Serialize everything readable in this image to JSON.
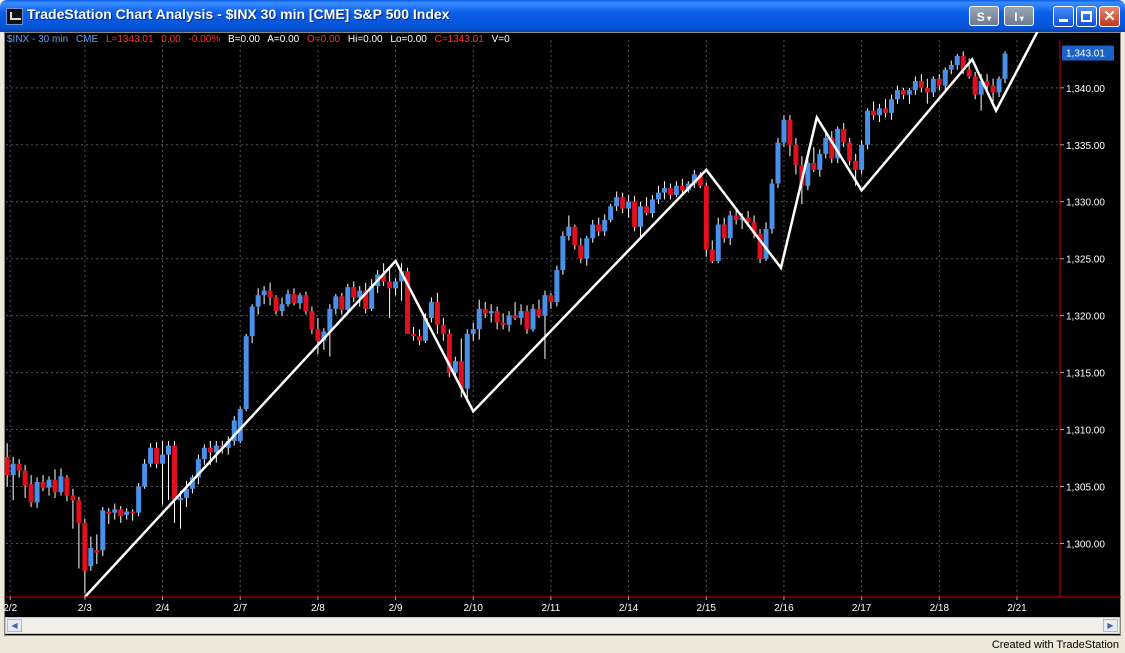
{
  "window": {
    "title": "TradeStation Chart Analysis - $INX 30 min [CME] S&P 500 Index",
    "menu_buttons": [
      "S",
      "I"
    ]
  },
  "status_bar": [
    {
      "text": "$INX - 30 min",
      "color": "#5aa0ff"
    },
    {
      "text": "CME",
      "color": "#5aa0ff"
    },
    {
      "text": "L=1343.01",
      "color": "#ff3030"
    },
    {
      "text": "0.00",
      "color": "#ff3030"
    },
    {
      "text": "-0.00%",
      "color": "#ff3030"
    },
    {
      "text": "B=0.00",
      "color": "#ffffff"
    },
    {
      "text": "A=0.00",
      "color": "#ffffff"
    },
    {
      "text": "O=0.00",
      "color": "#ff3030"
    },
    {
      "text": "Hi=0.00",
      "color": "#ffffff"
    },
    {
      "text": "Lo=0.00",
      "color": "#ffffff"
    },
    {
      "text": "C=1343.01",
      "color": "#ff3030"
    },
    {
      "text": "V=0",
      "color": "#ffffff"
    }
  ],
  "colors": {
    "up_bar": "#4a8fe8",
    "down_bar": "#e0101e",
    "zigzag": "#ffffff",
    "grid": "#555555",
    "price_scale_line": "#cc0000",
    "last_price_box": "#1a62c8"
  },
  "footer": "Created with TradeStation",
  "chart_data": {
    "type": "candlestick",
    "symbol": "$INX",
    "interval": "30 min",
    "y_ticks": [
      "1,300.00",
      "1,305.00",
      "1,310.00",
      "1,315.00",
      "1,320.00",
      "1,325.00",
      "1,330.00",
      "1,335.00",
      "1,340.00"
    ],
    "y_tick_values": [
      1300,
      1305,
      1310,
      1315,
      1320,
      1325,
      1330,
      1335,
      1340
    ],
    "ylim": [
      1295.3,
      1344.2
    ],
    "last_price_label": "1,343.01",
    "last_price": 1343.01,
    "x_labels": [
      "2/2",
      "2/3",
      "2/4",
      "2/7",
      "2/8",
      "2/9",
      "2/10",
      "2/11",
      "2/14",
      "2/15",
      "2/16",
      "2/17",
      "2/18",
      "2/21"
    ],
    "x_label_positions": [
      0.5,
      13,
      26,
      39,
      52,
      65,
      78,
      91,
      104,
      117,
      130,
      143,
      156,
      169
    ],
    "x_range": [
      -0.2,
      176.2
    ],
    "grid": true,
    "zigzag": {
      "x": [
        13,
        65,
        78,
        117,
        129.5,
        135.5,
        143,
        161.5,
        165.5,
        172.5
      ],
      "y": [
        1295.3,
        1324.8,
        1311.6,
        1332.8,
        1324.2,
        1337.4,
        1331.0,
        1342.5,
        1338.0,
        1345.0
      ]
    },
    "candles": [
      {
        "o": 1307.6,
        "h": 1308.8,
        "l": 1305.0,
        "c": 1306.0
      },
      {
        "o": 1306.0,
        "h": 1307.6,
        "l": 1303.8,
        "c": 1307.0
      },
      {
        "o": 1307.0,
        "h": 1307.4,
        "l": 1305.8,
        "c": 1306.4
      },
      {
        "o": 1306.4,
        "h": 1306.9,
        "l": 1304.0,
        "c": 1305.1
      },
      {
        "o": 1305.2,
        "h": 1306.0,
        "l": 1303.2,
        "c": 1303.6
      },
      {
        "o": 1303.6,
        "h": 1305.8,
        "l": 1303.1,
        "c": 1305.4
      },
      {
        "o": 1305.4,
        "h": 1306.0,
        "l": 1304.6,
        "c": 1304.9
      },
      {
        "o": 1304.9,
        "h": 1305.9,
        "l": 1304.2,
        "c": 1305.6
      },
      {
        "o": 1305.6,
        "h": 1306.5,
        "l": 1304.0,
        "c": 1304.5
      },
      {
        "o": 1304.5,
        "h": 1306.6,
        "l": 1304.2,
        "c": 1305.9
      },
      {
        "o": 1305.8,
        "h": 1306.0,
        "l": 1303.7,
        "c": 1304.2
      },
      {
        "o": 1304.2,
        "h": 1304.8,
        "l": 1301.3,
        "c": 1303.8
      },
      {
        "o": 1303.8,
        "h": 1304.1,
        "l": 1297.8,
        "c": 1301.8
      },
      {
        "o": 1301.8,
        "h": 1302.2,
        "l": 1295.6,
        "c": 1297.6
      },
      {
        "o": 1298.0,
        "h": 1300.6,
        "l": 1297.6,
        "c": 1299.6
      },
      {
        "o": 1299.4,
        "h": 1300.8,
        "l": 1298.2,
        "c": 1299.2
      },
      {
        "o": 1299.4,
        "h": 1303.2,
        "l": 1298.9,
        "c": 1302.9
      },
      {
        "o": 1302.8,
        "h": 1303.1,
        "l": 1301.7,
        "c": 1302.6
      },
      {
        "o": 1302.7,
        "h": 1303.5,
        "l": 1302.1,
        "c": 1303.0
      },
      {
        "o": 1303.0,
        "h": 1303.3,
        "l": 1301.8,
        "c": 1302.4
      },
      {
        "o": 1302.5,
        "h": 1303.1,
        "l": 1302.1,
        "c": 1302.8
      },
      {
        "o": 1302.8,
        "h": 1303.0,
        "l": 1302.0,
        "c": 1302.7
      },
      {
        "o": 1302.7,
        "h": 1305.3,
        "l": 1302.4,
        "c": 1305.0
      },
      {
        "o": 1305.0,
        "h": 1307.4,
        "l": 1304.8,
        "c": 1307.0
      },
      {
        "o": 1307.0,
        "h": 1308.8,
        "l": 1306.7,
        "c": 1308.4
      },
      {
        "o": 1308.4,
        "h": 1308.9,
        "l": 1306.6,
        "c": 1307.0
      },
      {
        "o": 1307.0,
        "h": 1309.0,
        "l": 1303.4,
        "c": 1307.8
      },
      {
        "o": 1307.8,
        "h": 1309.0,
        "l": 1303.8,
        "c": 1308.6
      },
      {
        "o": 1308.6,
        "h": 1309.0,
        "l": 1301.8,
        "c": 1303.8
      },
      {
        "o": 1303.8,
        "h": 1304.6,
        "l": 1301.3,
        "c": 1304.0
      },
      {
        "o": 1304.0,
        "h": 1305.5,
        "l": 1303.2,
        "c": 1304.8
      },
      {
        "o": 1304.8,
        "h": 1306.0,
        "l": 1304.4,
        "c": 1305.8
      },
      {
        "o": 1305.8,
        "h": 1307.8,
        "l": 1305.2,
        "c": 1307.4
      },
      {
        "o": 1307.4,
        "h": 1308.7,
        "l": 1306.9,
        "c": 1308.4
      },
      {
        "o": 1308.4,
        "h": 1309.0,
        "l": 1306.9,
        "c": 1308.0
      },
      {
        "o": 1308.0,
        "h": 1309.0,
        "l": 1307.1,
        "c": 1308.6
      },
      {
        "o": 1308.6,
        "h": 1309.0,
        "l": 1307.9,
        "c": 1308.4
      },
      {
        "o": 1308.4,
        "h": 1309.4,
        "l": 1307.8,
        "c": 1309.0
      },
      {
        "o": 1309.0,
        "h": 1311.2,
        "l": 1308.6,
        "c": 1310.8
      },
      {
        "o": 1309.0,
        "h": 1312.0,
        "l": 1308.8,
        "c": 1311.8
      },
      {
        "o": 1311.8,
        "h": 1318.4,
        "l": 1311.6,
        "c": 1318.2
      },
      {
        "o": 1318.2,
        "h": 1321.0,
        "l": 1317.6,
        "c": 1320.8
      },
      {
        "o": 1320.8,
        "h": 1322.4,
        "l": 1320.1,
        "c": 1321.8
      },
      {
        "o": 1321.8,
        "h": 1322.6,
        "l": 1321.0,
        "c": 1322.2
      },
      {
        "o": 1322.2,
        "h": 1322.9,
        "l": 1320.9,
        "c": 1321.6
      },
      {
        "o": 1321.6,
        "h": 1321.8,
        "l": 1320.1,
        "c": 1320.4
      },
      {
        "o": 1320.4,
        "h": 1321.6,
        "l": 1320.0,
        "c": 1321.0
      },
      {
        "o": 1321.0,
        "h": 1322.3,
        "l": 1320.8,
        "c": 1321.9
      },
      {
        "o": 1321.9,
        "h": 1322.4,
        "l": 1320.9,
        "c": 1321.1
      },
      {
        "o": 1321.1,
        "h": 1322.0,
        "l": 1320.6,
        "c": 1321.8
      },
      {
        "o": 1321.8,
        "h": 1322.1,
        "l": 1320.1,
        "c": 1320.4
      },
      {
        "o": 1320.4,
        "h": 1320.8,
        "l": 1318.4,
        "c": 1318.8
      },
      {
        "o": 1318.8,
        "h": 1319.8,
        "l": 1316.6,
        "c": 1317.8
      },
      {
        "o": 1317.8,
        "h": 1318.9,
        "l": 1317.0,
        "c": 1318.6
      },
      {
        "o": 1318.6,
        "h": 1321.0,
        "l": 1316.4,
        "c": 1320.6
      },
      {
        "o": 1320.6,
        "h": 1321.9,
        "l": 1320.1,
        "c": 1321.7
      },
      {
        "o": 1321.7,
        "h": 1322.0,
        "l": 1320.1,
        "c": 1320.5
      },
      {
        "o": 1320.5,
        "h": 1322.8,
        "l": 1320.2,
        "c": 1322.5
      },
      {
        "o": 1322.5,
        "h": 1323.0,
        "l": 1321.2,
        "c": 1321.6
      },
      {
        "o": 1321.6,
        "h": 1322.6,
        "l": 1320.8,
        "c": 1322.2
      },
      {
        "o": 1322.2,
        "h": 1322.9,
        "l": 1320.2,
        "c": 1320.6
      },
      {
        "o": 1320.6,
        "h": 1323.2,
        "l": 1320.4,
        "c": 1322.6
      },
      {
        "o": 1322.6,
        "h": 1324.0,
        "l": 1322.0,
        "c": 1323.6
      },
      {
        "o": 1323.6,
        "h": 1324.6,
        "l": 1322.6,
        "c": 1323.0
      },
      {
        "o": 1323.0,
        "h": 1324.2,
        "l": 1319.8,
        "c": 1322.4
      },
      {
        "o": 1322.4,
        "h": 1323.3,
        "l": 1321.8,
        "c": 1323.0
      },
      {
        "o": 1323.0,
        "h": 1324.6,
        "l": 1321.3,
        "c": 1323.9
      },
      {
        "o": 1323.9,
        "h": 1324.2,
        "l": 1319.8,
        "c": 1318.4
      },
      {
        "o": 1318.4,
        "h": 1319.0,
        "l": 1317.8,
        "c": 1318.2
      },
      {
        "o": 1318.2,
        "h": 1318.8,
        "l": 1317.4,
        "c": 1317.8
      },
      {
        "o": 1317.8,
        "h": 1320.2,
        "l": 1317.6,
        "c": 1319.8
      },
      {
        "o": 1319.8,
        "h": 1321.6,
        "l": 1319.4,
        "c": 1321.2
      },
      {
        "o": 1321.2,
        "h": 1322.0,
        "l": 1318.4,
        "c": 1319.2
      },
      {
        "o": 1319.2,
        "h": 1319.8,
        "l": 1317.8,
        "c": 1318.4
      },
      {
        "o": 1318.4,
        "h": 1318.8,
        "l": 1314.6,
        "c": 1315.0
      },
      {
        "o": 1315.0,
        "h": 1316.4,
        "l": 1314.6,
        "c": 1316.0
      },
      {
        "o": 1316.0,
        "h": 1318.0,
        "l": 1312.8,
        "c": 1313.6
      },
      {
        "o": 1313.6,
        "h": 1318.8,
        "l": 1312.4,
        "c": 1318.4
      },
      {
        "o": 1318.4,
        "h": 1319.4,
        "l": 1317.8,
        "c": 1318.8
      },
      {
        "o": 1318.8,
        "h": 1321.4,
        "l": 1317.9,
        "c": 1320.6
      },
      {
        "o": 1320.6,
        "h": 1321.2,
        "l": 1319.8,
        "c": 1320.2
      },
      {
        "o": 1320.2,
        "h": 1321.0,
        "l": 1319.4,
        "c": 1320.4
      },
      {
        "o": 1320.4,
        "h": 1320.8,
        "l": 1318.8,
        "c": 1319.4
      },
      {
        "o": 1319.4,
        "h": 1320.2,
        "l": 1318.8,
        "c": 1319.2
      },
      {
        "o": 1319.2,
        "h": 1320.4,
        "l": 1318.6,
        "c": 1320.0
      },
      {
        "o": 1320.0,
        "h": 1321.2,
        "l": 1319.6,
        "c": 1319.8
      },
      {
        "o": 1319.8,
        "h": 1321.0,
        "l": 1319.2,
        "c": 1320.4
      },
      {
        "o": 1320.4,
        "h": 1320.9,
        "l": 1318.4,
        "c": 1318.8
      },
      {
        "o": 1318.8,
        "h": 1321.0,
        "l": 1318.6,
        "c": 1320.6
      },
      {
        "o": 1320.6,
        "h": 1321.4,
        "l": 1319.8,
        "c": 1320.0
      },
      {
        "o": 1320.0,
        "h": 1322.2,
        "l": 1316.2,
        "c": 1321.8
      },
      {
        "o": 1321.8,
        "h": 1322.0,
        "l": 1320.6,
        "c": 1321.2
      },
      {
        "o": 1321.2,
        "h": 1324.4,
        "l": 1320.8,
        "c": 1324.0
      },
      {
        "o": 1324.0,
        "h": 1327.4,
        "l": 1323.6,
        "c": 1327.0
      },
      {
        "o": 1327.0,
        "h": 1328.8,
        "l": 1326.6,
        "c": 1327.8
      },
      {
        "o": 1327.8,
        "h": 1328.0,
        "l": 1325.8,
        "c": 1326.2
      },
      {
        "o": 1326.2,
        "h": 1326.8,
        "l": 1324.6,
        "c": 1325.0
      },
      {
        "o": 1325.0,
        "h": 1327.0,
        "l": 1324.4,
        "c": 1326.8
      },
      {
        "o": 1326.8,
        "h": 1328.4,
        "l": 1326.4,
        "c": 1328.0
      },
      {
        "o": 1328.0,
        "h": 1328.6,
        "l": 1327.0,
        "c": 1327.4
      },
      {
        "o": 1327.4,
        "h": 1328.9,
        "l": 1327.0,
        "c": 1328.4
      },
      {
        "o": 1328.4,
        "h": 1329.8,
        "l": 1328.2,
        "c": 1329.6
      },
      {
        "o": 1329.6,
        "h": 1330.9,
        "l": 1329.2,
        "c": 1330.4
      },
      {
        "o": 1330.4,
        "h": 1330.8,
        "l": 1329.0,
        "c": 1329.4
      },
      {
        "o": 1329.4,
        "h": 1330.6,
        "l": 1328.6,
        "c": 1330.0
      },
      {
        "o": 1330.0,
        "h": 1330.5,
        "l": 1327.4,
        "c": 1327.8
      },
      {
        "o": 1327.8,
        "h": 1330.0,
        "l": 1326.8,
        "c": 1329.6
      },
      {
        "o": 1329.6,
        "h": 1330.4,
        "l": 1328.8,
        "c": 1329.0
      },
      {
        "o": 1329.0,
        "h": 1330.6,
        "l": 1328.6,
        "c": 1330.2
      },
      {
        "o": 1330.2,
        "h": 1331.4,
        "l": 1329.8,
        "c": 1330.8
      },
      {
        "o": 1330.8,
        "h": 1331.8,
        "l": 1330.2,
        "c": 1331.2
      },
      {
        "o": 1331.2,
        "h": 1331.6,
        "l": 1330.2,
        "c": 1330.6
      },
      {
        "o": 1330.6,
        "h": 1331.8,
        "l": 1330.4,
        "c": 1331.4
      },
      {
        "o": 1331.4,
        "h": 1332.0,
        "l": 1330.6,
        "c": 1331.0
      },
      {
        "o": 1331.0,
        "h": 1331.8,
        "l": 1330.8,
        "c": 1331.6
      },
      {
        "o": 1331.6,
        "h": 1332.8,
        "l": 1331.2,
        "c": 1332.4
      },
      {
        "o": 1332.4,
        "h": 1332.6,
        "l": 1331.2,
        "c": 1331.4
      },
      {
        "o": 1331.4,
        "h": 1331.7,
        "l": 1325.2,
        "c": 1325.8
      },
      {
        "o": 1325.8,
        "h": 1326.6,
        "l": 1324.6,
        "c": 1324.8
      },
      {
        "o": 1324.8,
        "h": 1328.6,
        "l": 1324.6,
        "c": 1328.0
      },
      {
        "o": 1328.0,
        "h": 1328.6,
        "l": 1326.4,
        "c": 1326.8
      },
      {
        "o": 1326.8,
        "h": 1329.2,
        "l": 1326.2,
        "c": 1328.8
      },
      {
        "o": 1328.8,
        "h": 1329.4,
        "l": 1328.0,
        "c": 1328.4
      },
      {
        "o": 1328.4,
        "h": 1329.0,
        "l": 1327.6,
        "c": 1328.6
      },
      {
        "o": 1328.6,
        "h": 1329.2,
        "l": 1327.8,
        "c": 1328.2
      },
      {
        "o": 1328.2,
        "h": 1328.8,
        "l": 1326.8,
        "c": 1327.2
      },
      {
        "o": 1327.2,
        "h": 1327.6,
        "l": 1324.6,
        "c": 1325.0
      },
      {
        "o": 1325.0,
        "h": 1328.2,
        "l": 1324.8,
        "c": 1327.6
      },
      {
        "o": 1327.6,
        "h": 1332.0,
        "l": 1327.2,
        "c": 1331.6
      },
      {
        "o": 1331.6,
        "h": 1335.6,
        "l": 1331.2,
        "c": 1335.2
      },
      {
        "o": 1335.2,
        "h": 1337.6,
        "l": 1334.8,
        "c": 1337.2
      },
      {
        "o": 1337.2,
        "h": 1337.6,
        "l": 1334.0,
        "c": 1335.0
      },
      {
        "o": 1335.0,
        "h": 1335.6,
        "l": 1332.4,
        "c": 1333.2
      },
      {
        "o": 1333.2,
        "h": 1334.0,
        "l": 1329.8,
        "c": 1331.4
      },
      {
        "o": 1331.4,
        "h": 1333.8,
        "l": 1331.0,
        "c": 1333.4
      },
      {
        "o": 1333.4,
        "h": 1334.8,
        "l": 1332.6,
        "c": 1332.8
      },
      {
        "o": 1332.8,
        "h": 1334.6,
        "l": 1332.2,
        "c": 1334.2
      },
      {
        "o": 1334.2,
        "h": 1336.0,
        "l": 1333.8,
        "c": 1335.6
      },
      {
        "o": 1335.6,
        "h": 1336.2,
        "l": 1333.4,
        "c": 1333.8
      },
      {
        "o": 1333.8,
        "h": 1336.6,
        "l": 1333.4,
        "c": 1336.4
      },
      {
        "o": 1336.4,
        "h": 1336.9,
        "l": 1334.8,
        "c": 1335.2
      },
      {
        "o": 1335.2,
        "h": 1335.6,
        "l": 1333.2,
        "c": 1333.6
      },
      {
        "o": 1333.6,
        "h": 1334.2,
        "l": 1331.4,
        "c": 1332.8
      },
      {
        "o": 1332.8,
        "h": 1335.4,
        "l": 1332.4,
        "c": 1335.0
      },
      {
        "o": 1335.0,
        "h": 1338.2,
        "l": 1334.6,
        "c": 1338.0
      },
      {
        "o": 1338.0,
        "h": 1338.8,
        "l": 1337.2,
        "c": 1337.6
      },
      {
        "o": 1337.6,
        "h": 1338.6,
        "l": 1337.0,
        "c": 1338.2
      },
      {
        "o": 1338.2,
        "h": 1339.0,
        "l": 1337.4,
        "c": 1337.8
      },
      {
        "o": 1337.8,
        "h": 1339.4,
        "l": 1337.2,
        "c": 1339.0
      },
      {
        "o": 1339.0,
        "h": 1340.2,
        "l": 1338.6,
        "c": 1339.8
      },
      {
        "o": 1339.8,
        "h": 1340.0,
        "l": 1339.0,
        "c": 1339.4
      },
      {
        "o": 1339.4,
        "h": 1340.0,
        "l": 1338.6,
        "c": 1339.8
      },
      {
        "o": 1339.8,
        "h": 1341.0,
        "l": 1339.4,
        "c": 1340.6
      },
      {
        "o": 1340.6,
        "h": 1341.2,
        "l": 1339.6,
        "c": 1340.0
      },
      {
        "o": 1340.0,
        "h": 1340.8,
        "l": 1338.6,
        "c": 1339.6
      },
      {
        "o": 1339.6,
        "h": 1341.0,
        "l": 1339.2,
        "c": 1340.8
      },
      {
        "o": 1340.8,
        "h": 1341.2,
        "l": 1339.8,
        "c": 1340.2
      },
      {
        "o": 1340.2,
        "h": 1341.8,
        "l": 1339.8,
        "c": 1341.6
      },
      {
        "o": 1341.6,
        "h": 1342.4,
        "l": 1341.2,
        "c": 1342.0
      },
      {
        "o": 1342.0,
        "h": 1343.0,
        "l": 1341.6,
        "c": 1342.8
      },
      {
        "o": 1342.8,
        "h": 1343.2,
        "l": 1341.2,
        "c": 1341.6
      },
      {
        "o": 1341.6,
        "h": 1342.6,
        "l": 1340.8,
        "c": 1341.0
      },
      {
        "o": 1341.0,
        "h": 1341.4,
        "l": 1339.0,
        "c": 1339.4
      },
      {
        "o": 1339.4,
        "h": 1341.2,
        "l": 1338.0,
        "c": 1340.6
      },
      {
        "o": 1340.6,
        "h": 1341.2,
        "l": 1339.8,
        "c": 1340.2
      },
      {
        "o": 1340.2,
        "h": 1340.8,
        "l": 1338.4,
        "c": 1339.6
      },
      {
        "o": 1339.6,
        "h": 1341.0,
        "l": 1339.2,
        "c": 1340.8
      },
      {
        "o": 1340.8,
        "h": 1343.2,
        "l": 1340.4,
        "c": 1343.0
      }
    ]
  }
}
